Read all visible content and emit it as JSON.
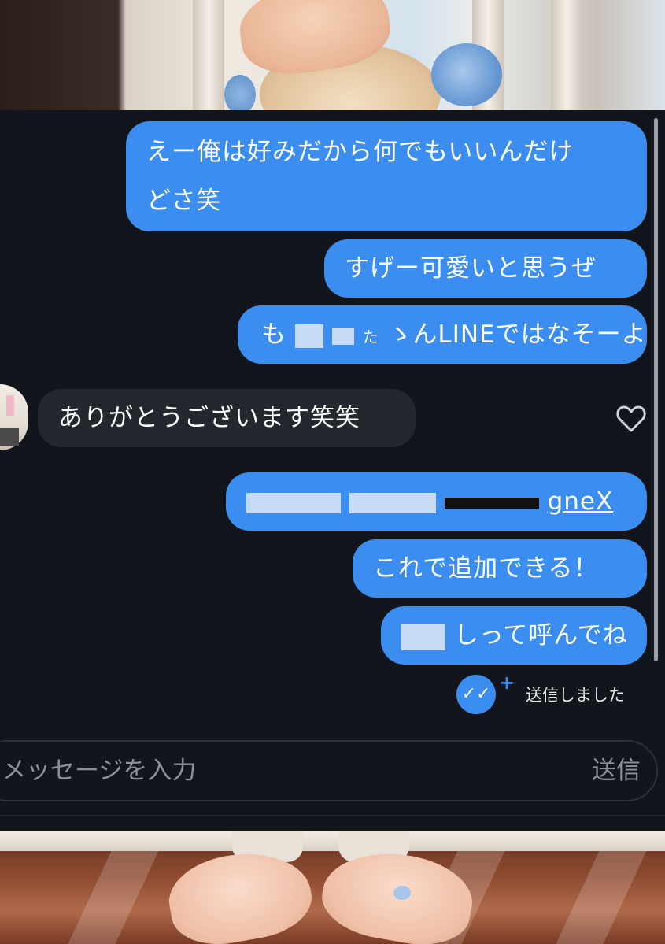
{
  "messages": {
    "m1_line1": "えー俺は好みだから何でもいいんだけ",
    "m1_line2": "どさ笑",
    "m2": "すげー可愛いと思うぜ",
    "m3_visible_a": "も",
    "m3_visible_b": "た",
    "m3_visible_c": "ゝんLINEではなそーよ",
    "m4": "ありがとうございます笑笑",
    "m5_visible_end": "gneX",
    "m6": "これで追加できる！",
    "m7_visible": "しって呼んでね"
  },
  "status": {
    "sent_label": "送信しました",
    "check_glyph": "✓✓",
    "plus_glyph": "+"
  },
  "composer": {
    "placeholder": "メッセージを入力",
    "send_label": "送信"
  },
  "icons": {
    "heart": "heart-icon",
    "read_receipt": "double-check-icon"
  },
  "colors": {
    "outgoing_bubble": "#3b8ef0",
    "incoming_bubble": "#23272e",
    "chat_background": "#12161c"
  }
}
